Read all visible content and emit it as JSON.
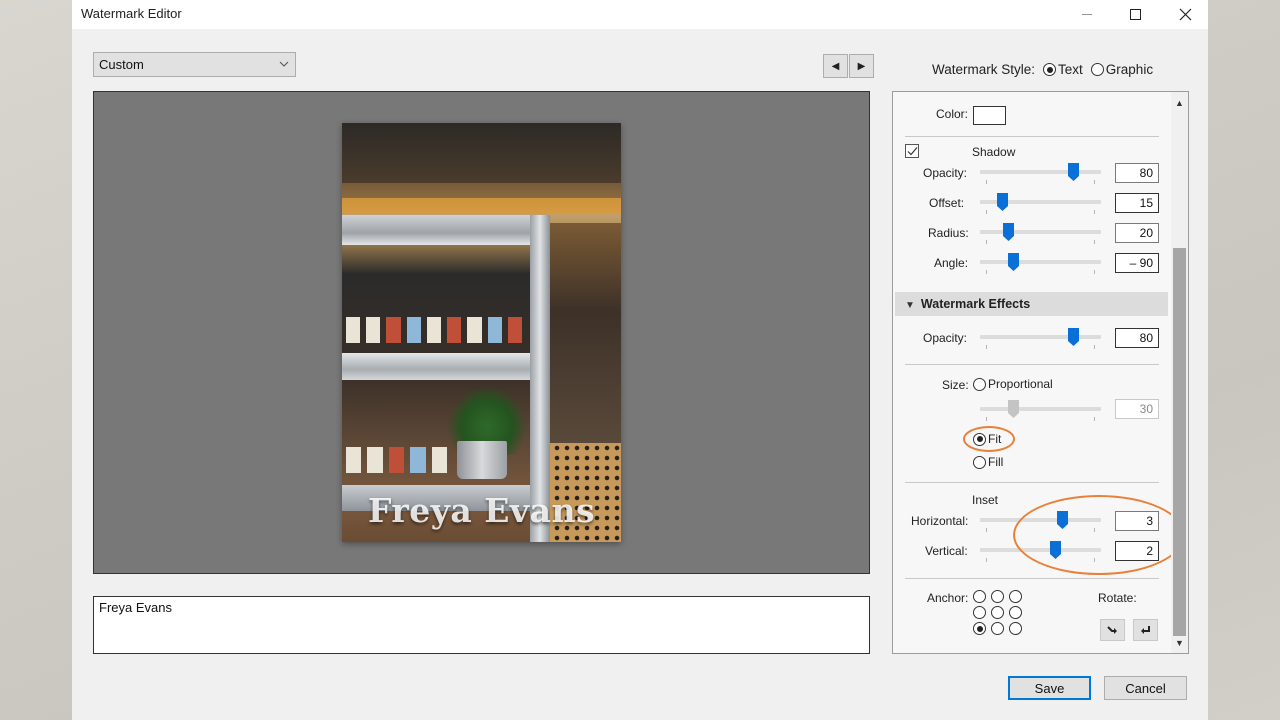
{
  "window": {
    "title": "Watermark Editor",
    "controls": [
      "minimize",
      "maximize",
      "close"
    ]
  },
  "toolbar": {
    "preset_value": "Custom",
    "prev_label": "◀",
    "next_label": "▶",
    "watermark_style_label": "Watermark Style:",
    "style_options": [
      {
        "label": "Text",
        "selected": true
      },
      {
        "label": "Graphic",
        "selected": false
      }
    ]
  },
  "preview": {
    "watermark_text": "Freya Evans",
    "image_description": "wine bar interior with bottles on stainless steel shelves"
  },
  "text_input": {
    "value": "Freya Evans"
  },
  "panel": {
    "color_label": "Color:",
    "color_value": "#ffffff",
    "shadow": {
      "label": "Shadow",
      "enabled": true,
      "opacity": {
        "label": "Opacity:",
        "value": "80",
        "fraction": 0.8
      },
      "offset": {
        "label": "Offset:",
        "value": "15",
        "fraction": 0.15
      },
      "radius": {
        "label": "Radius:",
        "value": "20",
        "fraction": 0.2
      },
      "angle": {
        "label": "Angle:",
        "value": "– 90",
        "fraction": 0.25
      }
    },
    "effects": {
      "header": "Watermark Effects",
      "opacity": {
        "label": "Opacity:",
        "value": "80",
        "fraction": 0.8
      },
      "size_label": "Size:",
      "size_options": [
        {
          "label": "Proportional",
          "selected": false
        },
        {
          "label": "Fit",
          "selected": true
        },
        {
          "label": "Fill",
          "selected": false
        }
      ],
      "proportional": {
        "value": "30",
        "fraction": 0.25,
        "disabled": true
      },
      "inset_label": "Inset",
      "horizontal": {
        "label": "Horizontal:",
        "value": "3",
        "fraction": 0.7
      },
      "vertical": {
        "label": "Vertical:",
        "value": "2",
        "fraction": 0.63
      },
      "anchor_label": "Anchor:",
      "anchor_selected": "bottom-left",
      "rotate_label": "Rotate:"
    }
  },
  "footer": {
    "save_label": "Save",
    "cancel_label": "Cancel"
  },
  "annotations": {
    "highlight_color": "#e8803a",
    "highlighted": [
      "size-fit-option",
      "inset-sliders"
    ]
  }
}
